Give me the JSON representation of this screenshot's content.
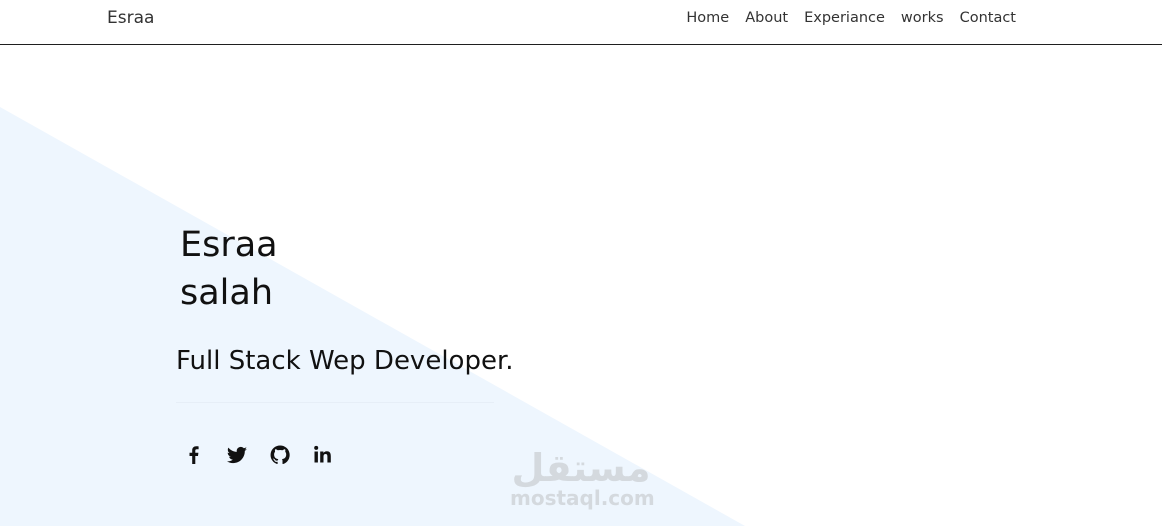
{
  "navbar": {
    "brand": "Esraa",
    "links": [
      {
        "label": "Home"
      },
      {
        "label": "About"
      },
      {
        "label": "Experiance"
      },
      {
        "label": "works"
      },
      {
        "label": "Contact"
      }
    ]
  },
  "hero": {
    "first_name": "Esraa",
    "last_name": "salah",
    "role": "Full Stack Wep Developer.",
    "socials": [
      {
        "icon": "facebook-icon"
      },
      {
        "icon": "twitter-icon"
      },
      {
        "icon": "github-icon"
      },
      {
        "icon": "linkedin-icon"
      }
    ],
    "background_color": "#eef6fe"
  },
  "watermark": {
    "arabic": "مستقل",
    "latin": "mostaql.com"
  },
  "colors": {
    "text": "#111111",
    "nav_text": "#333333",
    "nav_border": "#1f1f1f",
    "accent_bg": "#eef6fe"
  }
}
